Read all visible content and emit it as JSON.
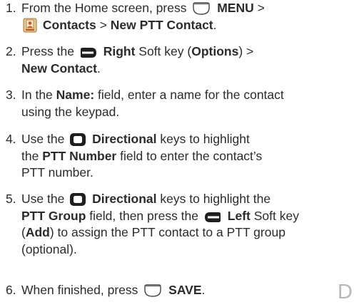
{
  "steps": [
    {
      "num": "1.",
      "line1_pre": "From the Home screen, press",
      "line1_bold": "MENU",
      "line1_sep": ">",
      "line2_bold_a": "Contacts",
      "line2_mid": ">",
      "line2_bold_b": "New PTT Contact",
      "line2_end": "."
    },
    {
      "num": "2.",
      "l1_pre": "Press the",
      "l1_bold": "Right",
      "l1_mid": "Soft key (",
      "l1_bold2": "Options",
      "l1_end": ") >",
      "l2_bold": "New Contact",
      "l2_end": "."
    },
    {
      "num": "3.",
      "l1_pre": "In the",
      "l1_bold": "Name:",
      "l1_end": "field, enter a name for the contact",
      "l2": "using the keypad."
    },
    {
      "num": "4.",
      "l1_pre": "Use the",
      "l1_bold": "Directional",
      "l1_end": "keys to highlight",
      "l2_pre": "the",
      "l2_bold": "PTT Number",
      "l2_end": "field to enter the contact’s",
      "l3": "PTT number."
    },
    {
      "num": "5.",
      "l1_pre": "Use the",
      "l1_bold": "Directional",
      "l1_end": "keys to highlight the",
      "l2_bold": "PTT Group",
      "l2_mid": "field, then press the",
      "l2_bold2": "Left",
      "l2_end": "Soft key",
      "l3_pre": "(",
      "l3_bold": "Add",
      "l3_end": ") to assign the PTT contact to a PTT group",
      "l4": "(optional)."
    },
    {
      "num": "6.",
      "l1_pre": "When finished, press",
      "l1_bold": "SAVE",
      "l1_end": "."
    }
  ],
  "side_letter": "D",
  "icons": [
    "menu-key-icon",
    "contacts-icon",
    "right-softkey-icon",
    "directional-key-icon",
    "left-softkey-icon",
    "center-key-icon"
  ]
}
